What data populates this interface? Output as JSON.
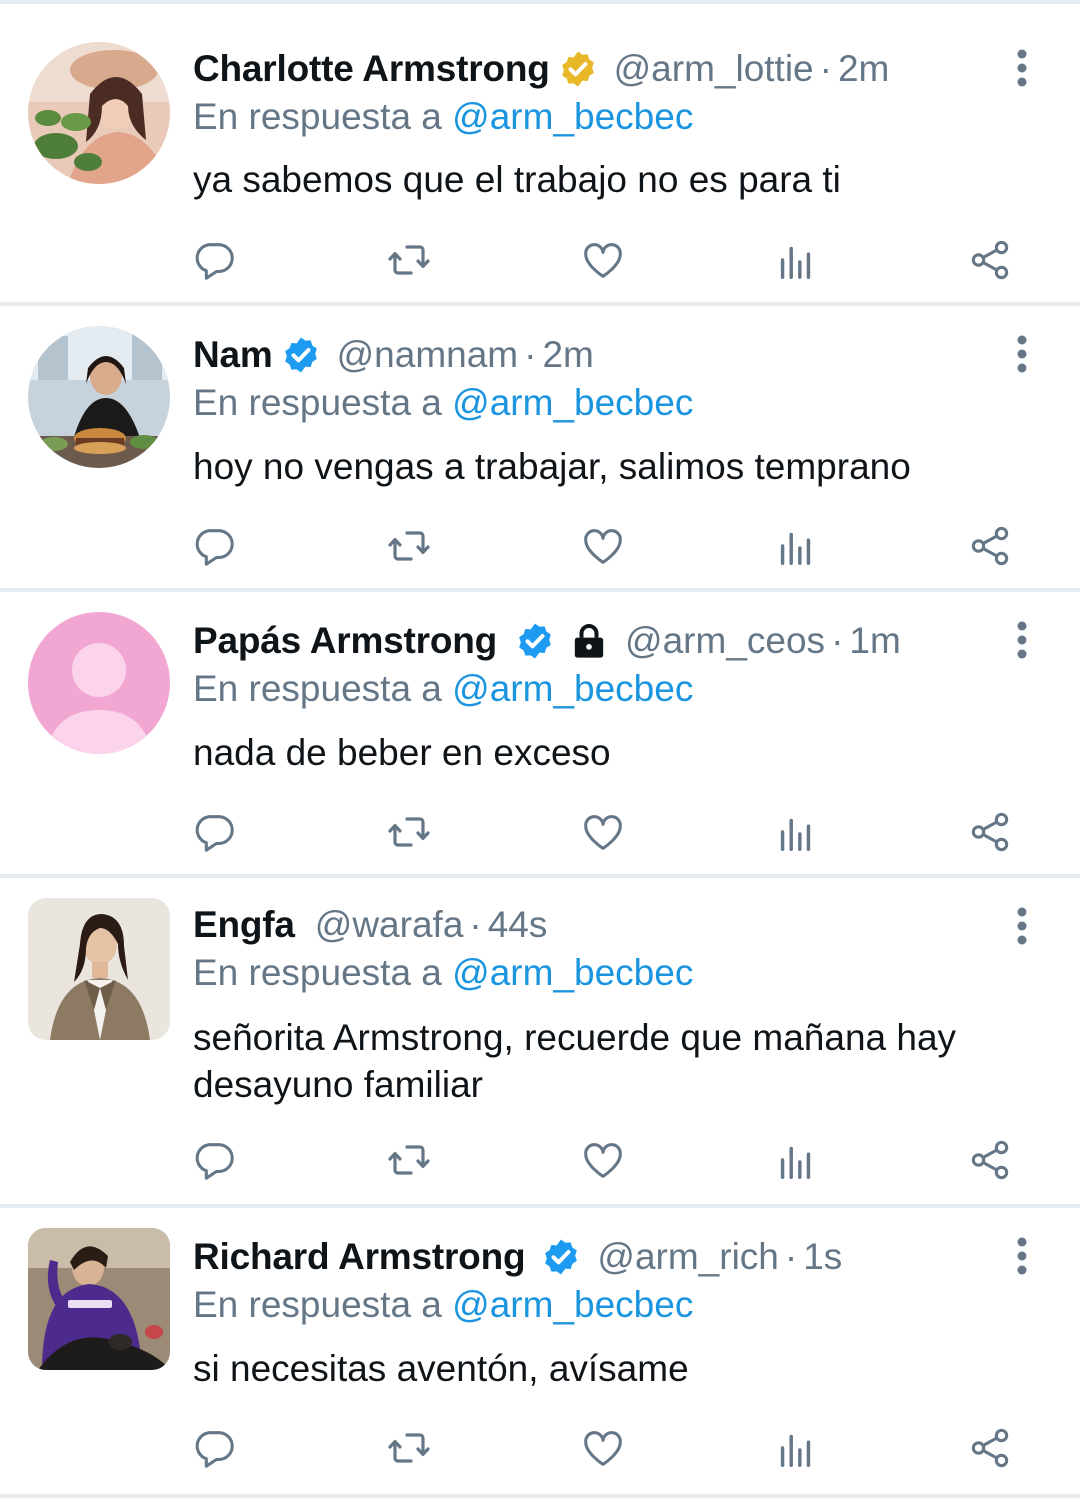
{
  "colors": {
    "accent": "#1b95e0",
    "muted": "#657786",
    "verified": "#1d9bf0",
    "verified_gold": "#e8b829",
    "divider": "#e6ecf0"
  },
  "reply_prefix": "En respuesta a",
  "tweets": [
    {
      "name": "Charlotte Armstrong",
      "badge": "verified-gold-icon",
      "locked": false,
      "handle": "@arm_lottie",
      "time": "2m",
      "reply_to": "@arm_becbec",
      "text": "ya sabemos que el trabajo no es para ti"
    },
    {
      "name": "Nam",
      "badge": "verified-blue-icon",
      "locked": false,
      "handle": "@namnam",
      "time": "2m",
      "reply_to": "@arm_becbec",
      "text": "hoy no vengas a trabajar, salimos temprano"
    },
    {
      "name": "Papás Armstrong",
      "badge": "verified-blue-icon",
      "locked": true,
      "handle": "@arm_ceos",
      "time": "1m",
      "reply_to": "@arm_becbec",
      "text": "nada de beber en exceso"
    },
    {
      "name": "Engfa",
      "badge": "none",
      "locked": false,
      "handle": "@warafa",
      "time": "44s",
      "reply_to": "@arm_becbec",
      "text": "señorita Armstrong, recuerde que mañana hay desayuno familiar"
    },
    {
      "name": "Richard Armstrong",
      "badge": "verified-blue-icon",
      "locked": false,
      "handle": "@arm_rich",
      "time": "1s",
      "reply_to": "@arm_becbec",
      "text": "si necesitas aventón, avísame"
    }
  ],
  "action_icons": [
    "reply-icon",
    "retweet-icon",
    "like-icon",
    "analytics-icon",
    "share-icon"
  ]
}
